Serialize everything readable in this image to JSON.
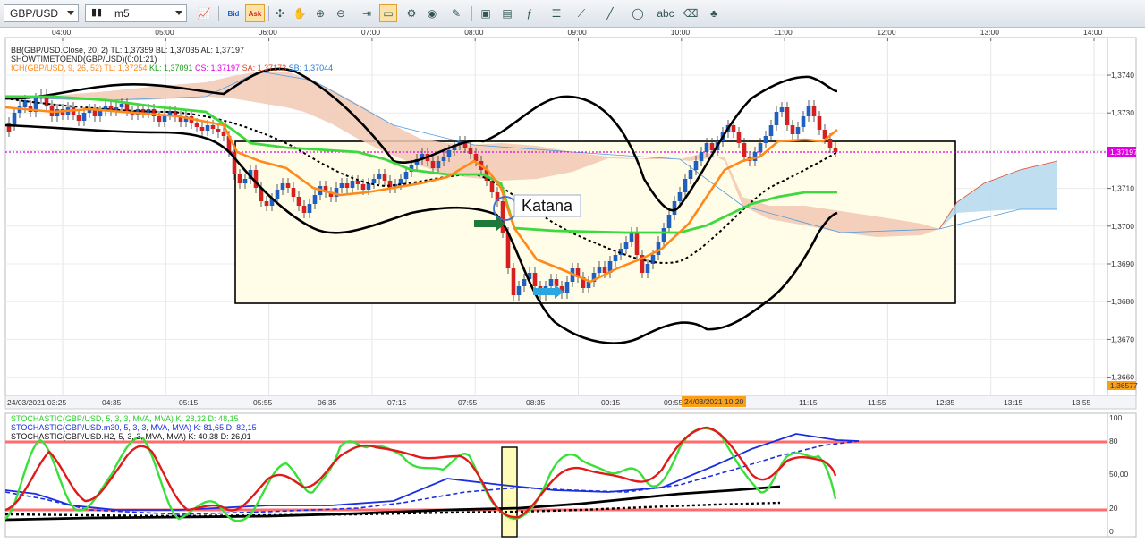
{
  "toolbar": {
    "symbol": "GBP/USD",
    "timeframe": "m5",
    "bid_label": "Bid",
    "ask_label": "Ask"
  },
  "indicators": {
    "bb": "BB(GBP/USD.Close, 20, 2)  TL: 1,37359  BL: 1,37035  AL: 1,37197",
    "showtime": "SHOWTIMETOEND(GBP/USD)(0:01:21)",
    "ich_name": "ICH(GBP/USD, 9, 26, 52)",
    "ich_tl": "TL: 1,37254",
    "ich_kl": "KL: 1,37091",
    "ich_cs": "CS: 1,37197",
    "ich_sa": "SA: 1,37173",
    "ich_sb": "SB: 1,37044"
  },
  "top_time_axis": [
    "04:00",
    "05:00",
    "06:00",
    "07:00",
    "08:00",
    "09:00",
    "10:00",
    "11:00",
    "12:00",
    "13:00",
    "14:00"
  ],
  "price_axis": [
    "1,3740",
    "1,3730",
    "1,3720",
    "1,3710",
    "1,3700",
    "1,3690",
    "1,3680",
    "1,3670",
    "1,3660"
  ],
  "current_price": "1,37197",
  "bottom_price": "1,36577",
  "bottom_time_axis": [
    "24/03/2021 03:25",
    "04:35",
    "05:15",
    "05:55",
    "06:35",
    "07:15",
    "07:55",
    "08:35",
    "09:15",
    "09:55",
    "11:15",
    "11:55",
    "12:35",
    "13:15",
    "13:55"
  ],
  "cursor_time": "24/03/2021 10:20",
  "annotation": "Katana",
  "stoch": {
    "line1": "STOCHASTIC(GBP/USD, 5, 3, 3, MVA, MVA)  K: 28,32  D: 48,15",
    "line2": "STOCHASTIC(GBP/USD.m30, 5, 3, 3, MVA, MVA)  K: 81,65  D: 82,15",
    "line3": "STOCHASTIC(GBP/USD.H2, 5, 3, 3, MVA, MVA)  K: 40,38  D: 26,01",
    "axis": [
      "100",
      "80",
      "50,00",
      "20",
      "0"
    ]
  },
  "colors": {
    "bull": "#1f5fbf",
    "bear": "#d62020",
    "tenkan": "#ff8a1a",
    "kijun": "#3fd83f",
    "cursor_price": "#e000e0",
    "cloud_bear": "#f2c8b4",
    "cloud_bull": "#b8dcef"
  }
}
